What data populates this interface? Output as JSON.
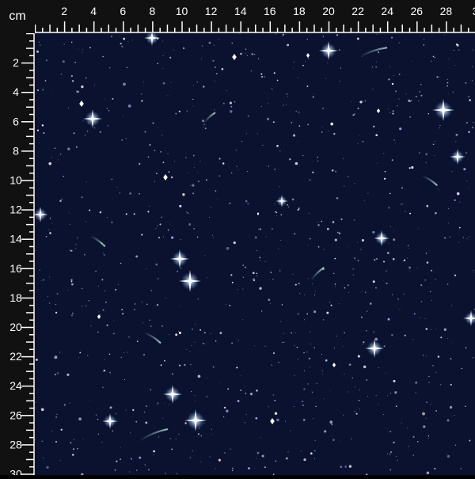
{
  "ruler": {
    "unit_label": "cm",
    "top_labels": [
      "2",
      "4",
      "6",
      "8",
      "10",
      "12",
      "14",
      "16",
      "18",
      "20",
      "22",
      "24",
      "26",
      "28",
      "3"
    ],
    "left_labels": [
      "2",
      "4",
      "6",
      "8",
      "10",
      "12",
      "14",
      "16",
      "18",
      "20",
      "22",
      "24",
      "26",
      "28",
      "30"
    ]
  },
  "colors": {
    "ruler_bg": "#111111",
    "ruler_ink": "#ffffff",
    "fabric_bg": "#0a1230"
  }
}
